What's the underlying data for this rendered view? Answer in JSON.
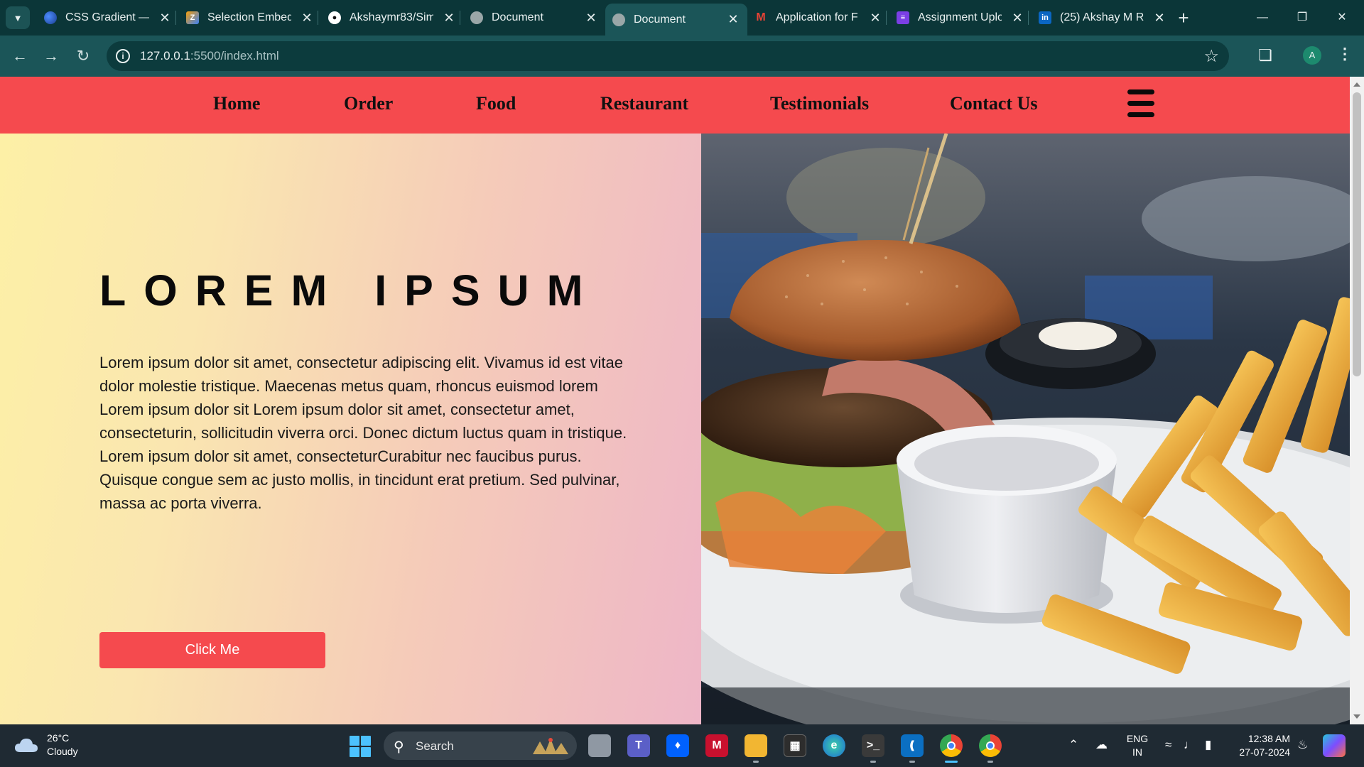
{
  "browser": {
    "tabs": [
      {
        "title": "CSS Gradient — ",
        "favicon": "css-gradient-favicon",
        "active": false
      },
      {
        "title": "Selection Embed",
        "favicon": "selection-embed-favicon",
        "active": false
      },
      {
        "title": "Akshaymr83/Sim",
        "favicon": "github-favicon",
        "active": false
      },
      {
        "title": "Document",
        "favicon": "globe-favicon",
        "active": false
      },
      {
        "title": "Document",
        "favicon": "globe-favicon",
        "active": true
      },
      {
        "title": "Application for F",
        "favicon": "gmail-favicon",
        "active": false
      },
      {
        "title": "Assignment Uplo",
        "favicon": "forms-favicon",
        "active": false
      },
      {
        "title": "(25) Akshay M R",
        "favicon": "linkedin-favicon",
        "active": false
      }
    ],
    "url_host": "127.0.0.1",
    "url_rest": ":5500/index.html",
    "profile_initial": "A"
  },
  "site": {
    "nav": [
      "Home",
      "Order",
      "Food",
      "Restaurant",
      "Testimonials",
      "Contact Us"
    ],
    "hero_title": "LOREM IPSUM",
    "hero_text": "Lorem ipsum dolor sit amet, consectetur adipiscing elit. Vivamus id est vitae dolor molestie tristique. Maecenas metus quam, rhoncus euismod lorem Lorem ipsum dolor sit Lorem ipsum dolor sit amet, consectetur amet, consecteturin, sollicitudin viverra orci. Donec dictum luctus quam in tristique. Lorem ipsum dolor sit amet, consecteturCurabitur nec faucibus purus. Quisque congue sem ac justo mollis, in tincidunt erat pretium. Sed pulvinar, massa ac porta viverra.",
    "button_label": "Click Me",
    "colors": {
      "accent": "#f54a4e",
      "gradient_start": "#fdf0a6",
      "gradient_end": "#eeb6c7"
    }
  },
  "taskbar": {
    "weather_temp": "26°C",
    "weather_desc": "Cloudy",
    "search_label": "Search",
    "lang_top": "ENG",
    "lang_bottom": "IN",
    "time": "12:38 AM",
    "date": "27-07-2024"
  }
}
